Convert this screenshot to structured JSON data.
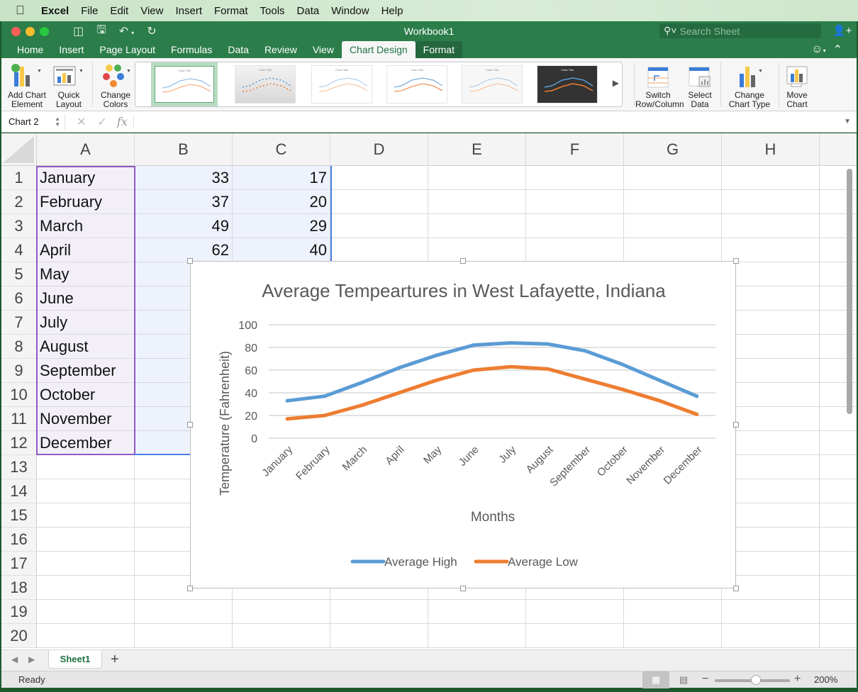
{
  "menubar": {
    "app": "Excel",
    "items": [
      "File",
      "Edit",
      "View",
      "Insert",
      "Format",
      "Tools",
      "Data",
      "Window",
      "Help"
    ]
  },
  "window": {
    "title": "Workbook1",
    "search_placeholder": "Search Sheet"
  },
  "tabs": [
    "Home",
    "Insert",
    "Page Layout",
    "Formulas",
    "Data",
    "Review",
    "View",
    "Chart Design",
    "Format"
  ],
  "active_tab": "Chart Design",
  "ribbon": {
    "add_chart_element": [
      "Add Chart",
      "Element"
    ],
    "quick_layout": [
      "Quick",
      "Layout"
    ],
    "change_colors": [
      "Change",
      "Colors"
    ],
    "switch_row_column": [
      "Switch",
      "Row/Column"
    ],
    "select_data": [
      "Select",
      "Data"
    ],
    "change_chart_type": [
      "Change",
      "Chart Type"
    ],
    "move_chart": [
      "Move",
      "Chart"
    ],
    "style_thumb_title": "Chart Title"
  },
  "formula_bar": {
    "name_box": "Chart 2",
    "fx": "fx",
    "value": ""
  },
  "columns": [
    "A",
    "B",
    "C",
    "D",
    "E",
    "F",
    "G",
    "H"
  ],
  "rows": [
    {
      "n": "1",
      "a": "January",
      "b": "33",
      "c": "17"
    },
    {
      "n": "2",
      "a": "February",
      "b": "37",
      "c": "20"
    },
    {
      "n": "3",
      "a": "March",
      "b": "49",
      "c": "29"
    },
    {
      "n": "4",
      "a": "April",
      "b": "62",
      "c": "40"
    },
    {
      "n": "5",
      "a": "May",
      "b": "",
      "c": ""
    },
    {
      "n": "6",
      "a": "June",
      "b": "",
      "c": ""
    },
    {
      "n": "7",
      "a": "July",
      "b": "",
      "c": ""
    },
    {
      "n": "8",
      "a": "August",
      "b": "",
      "c": ""
    },
    {
      "n": "9",
      "a": "September",
      "b": "",
      "c": ""
    },
    {
      "n": "10",
      "a": "October",
      "b": "",
      "c": ""
    },
    {
      "n": "11",
      "a": "November",
      "b": "",
      "c": ""
    },
    {
      "n": "12",
      "a": "December",
      "b": "",
      "c": ""
    },
    {
      "n": "13",
      "a": "",
      "b": "",
      "c": ""
    },
    {
      "n": "14",
      "a": "",
      "b": "",
      "c": ""
    },
    {
      "n": "15",
      "a": "",
      "b": "",
      "c": ""
    },
    {
      "n": "16",
      "a": "",
      "b": "",
      "c": ""
    },
    {
      "n": "17",
      "a": "",
      "b": "",
      "c": ""
    },
    {
      "n": "18",
      "a": "",
      "b": "",
      "c": ""
    },
    {
      "n": "19",
      "a": "",
      "b": "",
      "c": ""
    },
    {
      "n": "20",
      "a": "",
      "b": "",
      "c": ""
    }
  ],
  "sheet_tabs": [
    "Sheet1"
  ],
  "add_sheet": "+",
  "status": {
    "text": "Ready",
    "zoom": "200%",
    "zoom_level": 0.55
  },
  "colors": {
    "accent": "#2b7d4a",
    "high": "#5b9bd5",
    "low": "#ed7d31"
  },
  "chart_data": {
    "type": "line",
    "title": "Average Tempeartures in West Lafayette, Indiana",
    "xlabel": "Months",
    "ylabel": "Temperature (Fahrenheit)",
    "categories": [
      "January",
      "February",
      "March",
      "April",
      "May",
      "June",
      "July",
      "August",
      "September",
      "October",
      "November",
      "December"
    ],
    "series": [
      {
        "name": "Average High",
        "color": "#5b9bd5",
        "values": [
          33,
          37,
          49,
          62,
          73,
          82,
          84,
          83,
          77,
          65,
          51,
          37
        ]
      },
      {
        "name": "Average Low",
        "color": "#ed7d31",
        "values": [
          17,
          20,
          29,
          40,
          51,
          60,
          63,
          61,
          52,
          43,
          33,
          21
        ]
      }
    ],
    "ylim": [
      0,
      100
    ],
    "yticks": [
      0,
      20,
      40,
      60,
      80,
      100
    ],
    "grid": true,
    "legend": "bottom"
  }
}
